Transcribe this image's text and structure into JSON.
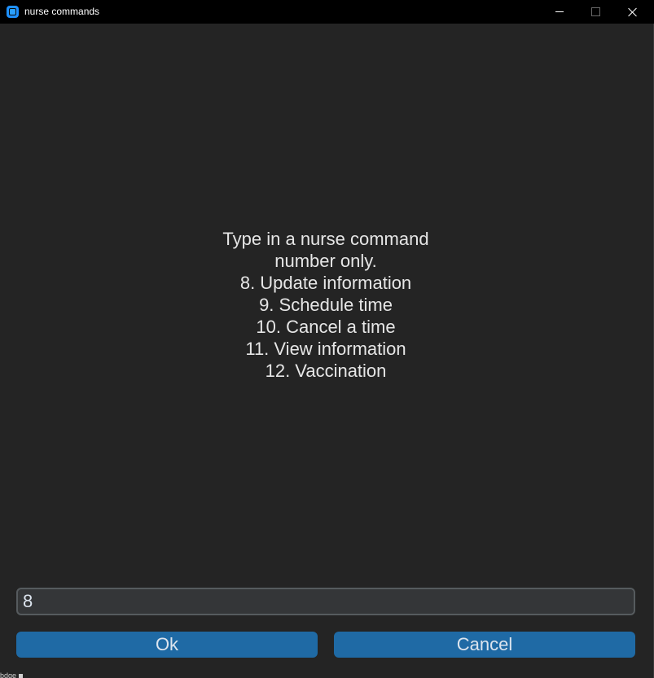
{
  "window": {
    "title": "nurse commands",
    "app_icon": "app-icon"
  },
  "prompt": {
    "lines": [
      "Type in a nurse command",
      "number only.",
      "8. Update information",
      "9. Schedule time",
      "10. Cancel a time",
      "11. View information",
      "12. Vaccination"
    ]
  },
  "input": {
    "value": "8"
  },
  "buttons": {
    "ok_label": "Ok",
    "cancel_label": "Cancel"
  },
  "footer": {
    "text": "bdge"
  },
  "colors": {
    "background": "#242424",
    "titlebar": "#000000",
    "button": "#1f6aa5",
    "entry_bg": "#343638",
    "entry_border": "#565b5e",
    "text": "#dce4ee"
  }
}
